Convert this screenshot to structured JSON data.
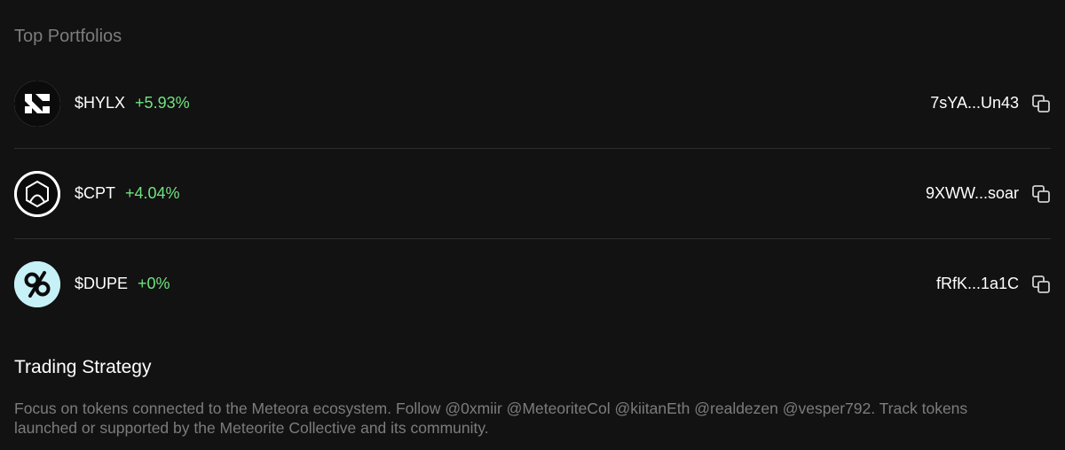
{
  "portfolios": {
    "title": "Top Portfolios",
    "items": [
      {
        "ticker": "$HYLX",
        "change": "+5.93%",
        "address": "7sYA...Un43",
        "logo": "hylx-logo"
      },
      {
        "ticker": "$CPT",
        "change": "+4.04%",
        "address": "9XWW...soar",
        "logo": "cpt-logo"
      },
      {
        "ticker": "$DUPE",
        "change": "+0%",
        "address": "fRfK...1a1C",
        "logo": "dupe-logo"
      }
    ]
  },
  "strategy": {
    "title": "Trading Strategy",
    "text": "Focus on tokens connected to the Meteora ecosystem. Follow @0xmiir @MeteoriteCol @kiitanEth @realdezen @vesper792. Track tokens launched or supported by the Meteorite Collective and its community."
  },
  "colors": {
    "background": "#121212",
    "positive": "#6fe37f",
    "muted": "#7c7c7c",
    "divider": "#2e2e2e"
  }
}
